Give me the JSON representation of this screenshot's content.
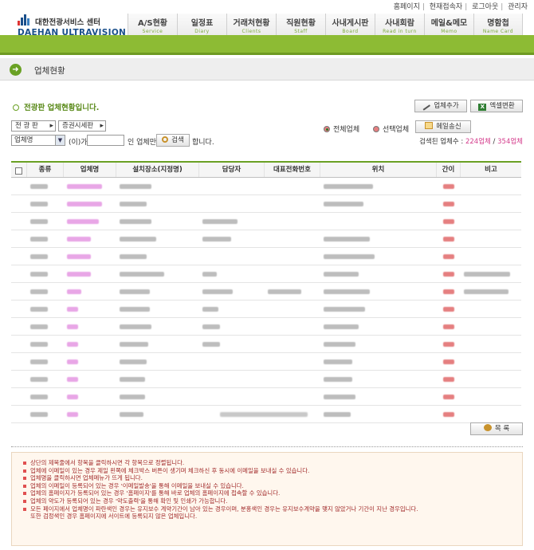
{
  "header": {
    "top_links": [
      "홈페이지",
      "현재접속자",
      "로그아웃",
      "관리자"
    ],
    "logo_ko": "대한전광서비스 센터",
    "logo_en": "DAEHAN ULTRAVISION"
  },
  "nav": [
    {
      "ko": "A/S현황",
      "en": "Service"
    },
    {
      "ko": "일정표",
      "en": "Diary"
    },
    {
      "ko": "거래처현황",
      "en": "Clients"
    },
    {
      "ko": "직원현황",
      "en": "Staff"
    },
    {
      "ko": "사내게시판",
      "en": "Board"
    },
    {
      "ko": "사내회람",
      "en": "Read in turn"
    },
    {
      "ko": "메일&메모",
      "en": "Memo"
    },
    {
      "ko": "명함첩",
      "en": "Name Card"
    }
  ],
  "page": {
    "title": "업체현황",
    "notice": "전광판 업체현황입니다."
  },
  "toolbar": {
    "add_company": "업체추가",
    "excel": "엑셀변환",
    "tab_signboard": "전 광 판",
    "tab_securities": "증권시세판",
    "radio_all": "전체업체",
    "radio_selected": "선택업체",
    "mail_send": "메일송신",
    "search_field": "업체명",
    "search_suffix_1": "(이)가",
    "search_suffix_2": "인 업체만",
    "search_button": "검색",
    "search_suffix_3": "합니다.",
    "count_label": "검색된 업체수 : ",
    "count_found": "224업체",
    "count_sep": " / ",
    "count_total": "354업체"
  },
  "table": {
    "headers": [
      "종류",
      "업체명",
      "설치장소(지정명)",
      "담당자",
      "대표전화번호",
      "위치",
      "간이",
      "비고"
    ]
  },
  "footer": {
    "list_button": "목  록",
    "notes": [
      "상단의 제목줄에서 항목을 클릭하시면 각 항목으로 정렬됩니다.",
      "업체에 이메일이 있는 경우 제일 왼쪽에 체크박스 버튼이 생기며 체크하신 후 동시에 이메일을 보내실 수 있습니다.",
      "업체명을 클릭하시면 업체메뉴가 뜨게 됩니다.",
      "업체의 이메일이 등록되어 있는 경우 '이메일발송'을 통해 이메일을 보내실 수 있습니다.",
      "업체의 홈페이지가 등록되어 있는 경우 '홈페이지'를 통해 바로 업체의 홈페이지에 접속할 수 있습니다.",
      "업체의 약도가 등록되어 있는 경우 '약도출력'을 통해 확인 및 인쇄가 가능합니다.",
      "모든 페이지에서 업체명이 파란색인 경우는 유지보수 계약기간이 남아 있는 경우이며, 분홍색인 경우는 유지보수계약을 맺지 않았거나 기간이 지난 경우입니다.",
      "또한 검정색인 경우 홈페이지에 서이트에 등록되지 않은 업체입니다."
    ]
  },
  "colors": {
    "accent_green": "#8dbb34",
    "highlight_pink": "#d43c8c",
    "note_red": "#a12a2a"
  }
}
